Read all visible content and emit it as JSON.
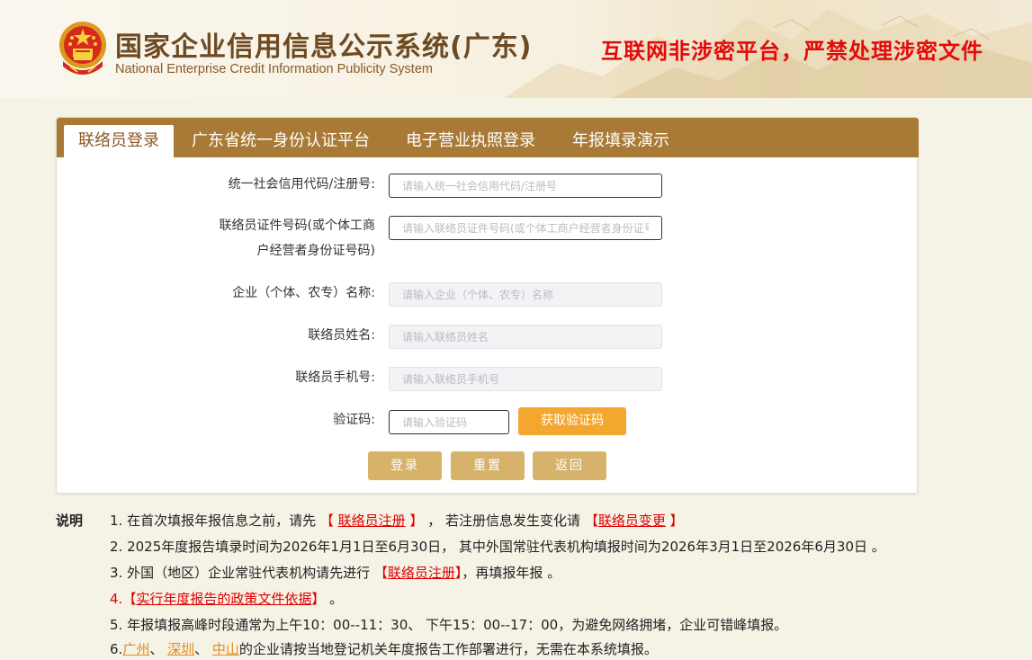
{
  "header": {
    "title": "国家企业信用信息公示系统(广东)",
    "subtitle": "National Enterprise Credit Information Publicity System",
    "warning": "互联网非涉密平台，严禁处理涉密文件"
  },
  "tabs": [
    {
      "label": "联络员登录"
    },
    {
      "label": "广东省统一身份认证平台"
    },
    {
      "label": "电子营业执照登录"
    },
    {
      "label": "年报填录演示"
    }
  ],
  "form": {
    "code_label": "统一社会信用代码/注册号:",
    "code_placeholder": "请输入统一社会信用代码/注册号",
    "idno_label_1": "联络员证件号码(或个体工商",
    "idno_label_2": "户经营者身份证号码)",
    "idno_placeholder": "请输入联络员证件号码(或个体工商户经营者身份证号码)",
    "name_label": "企业（个体、农专）名称:",
    "name_placeholder": "请输入企业（个体、农专）名称",
    "contact_label": "联络员姓名:",
    "contact_placeholder": "请输入联络员姓名",
    "phone_label": "联络员手机号:",
    "phone_placeholder": "请输入联络员手机号",
    "captcha_label": "验证码:",
    "captcha_placeholder": "请输入验证码",
    "sms_button": "获取验证码",
    "login_button": "登录",
    "reset_button": "重置",
    "back_button": "返回"
  },
  "notes": {
    "title": "说明",
    "n1_a": "1. 在首次填报年报信息之前，请先",
    "n1_b1": "【",
    "n1_link1": "联络员注册",
    "n1_b2": "】",
    "n1_c": "， 若注册信息发生变化请",
    "n1_b3": "【",
    "n1_link2": "联络员变更",
    "n1_b4": "】",
    "n2": "2. 2025年度报告填录时间为2026年1月1日至6月30日， 其中外国常驻代表机构填报时间为2026年3月1日至2026年6月30日 。",
    "n3_a": "3. 外国（地区）企业常驻代表机构请先进行",
    "n3_b1": "【",
    "n3_link": "联络员注册",
    "n3_b2": "】",
    "n3_c": "，再填报年报 。",
    "n4_num": "4.",
    "n4_b1": "【",
    "n4_link": "实行年度报告的政策文件依据",
    "n4_b2": "】",
    "n4_c": " 。",
    "n5": "5. 年报填报高峰时段通常为上午10：00--11：30、 下午15：00--17：00，为避免网络拥堵，企业可错峰填报。",
    "n6_num": "6.",
    "n6_city1": "广州",
    "n6_sep1": "、 ",
    "n6_city2": "深圳",
    "n6_sep2": "、 ",
    "n6_city3": "中山",
    "n6_c": "的企业请按当地登记机关年度报告工作部署进行，无需在本系统填报。"
  },
  "colors": {
    "tab_bar": "#a97a35",
    "title_brown": "#6e4a22",
    "warning_red": "#e30a0a",
    "sms_orange": "#f3a72f",
    "action_gold": "#d6b26a"
  }
}
